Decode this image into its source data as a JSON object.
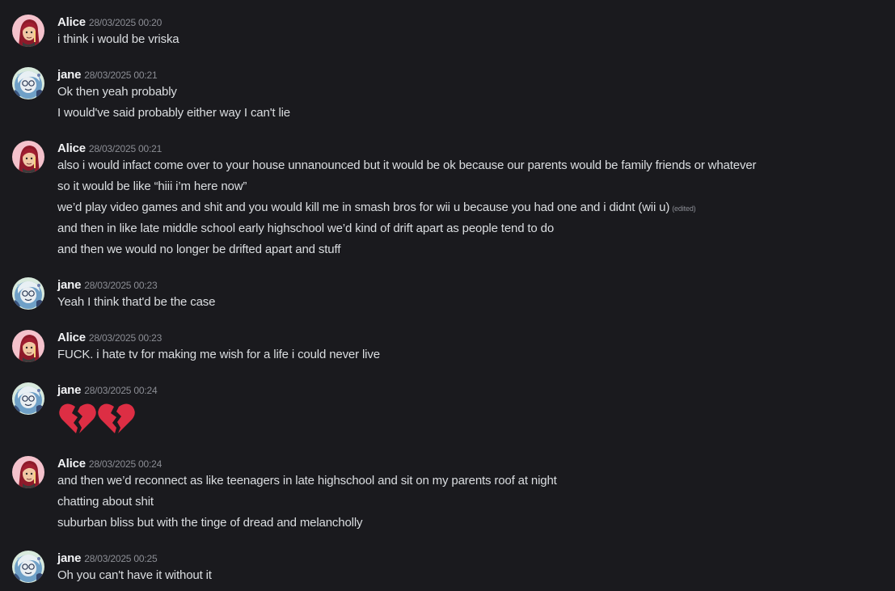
{
  "users": {
    "alice": {
      "name": "Alice"
    },
    "jane": {
      "name": "jane"
    }
  },
  "messages": [
    {
      "author": "Alice",
      "timestamp": "28/03/2025 00:20",
      "lines": [
        "i think i would be vriska"
      ]
    },
    {
      "author": "jane",
      "timestamp": "28/03/2025 00:21",
      "lines": [
        "Ok then yeah probably",
        "I would've said probably either way I can't lie"
      ]
    },
    {
      "author": "Alice",
      "timestamp": "28/03/2025 00:21",
      "lines": [
        "also i would infact come over to your house unnanounced but it would be ok because our parents would be family friends or whatever",
        "so it would be like “hiii i’m here now”",
        "we’d play video games and shit and you would kill me in smash bros for wii u because you had one and i didnt (wii u)",
        "and then in like late middle school early highschool we’d kind of drift apart as people tend to do",
        "and then we would no longer be drifted apart and stuff"
      ],
      "edited_label": "(edited)"
    },
    {
      "author": "jane",
      "timestamp": "28/03/2025 00:23",
      "lines": [
        "Yeah I think that'd be the case"
      ]
    },
    {
      "author": "Alice",
      "timestamp": "28/03/2025 00:23",
      "lines": [
        "FUCK. i hate tv for making me wish for a life i could never live"
      ]
    },
    {
      "author": "jane",
      "timestamp": "28/03/2025 00:24",
      "emoji": [
        "broken-heart-icon",
        "broken-heart-icon"
      ]
    },
    {
      "author": "Alice",
      "timestamp": "28/03/2025 00:24",
      "lines": [
        "and then we’d reconnect as like teenagers in late highschool and sit on my parents roof at night",
        "chatting about shit",
        "suburban bliss but with the tinge of dread and melancholly"
      ]
    },
    {
      "author": "jane",
      "timestamp": "28/03/2025 00:25",
      "lines": [
        "Oh you can't have it without it"
      ]
    }
  ],
  "colors": {
    "background": "#1a1a1e",
    "author": "#f2f3f5",
    "text": "#dbdee1",
    "timestamp": "#8b8d94",
    "broken_heart": "#dd2e44"
  }
}
